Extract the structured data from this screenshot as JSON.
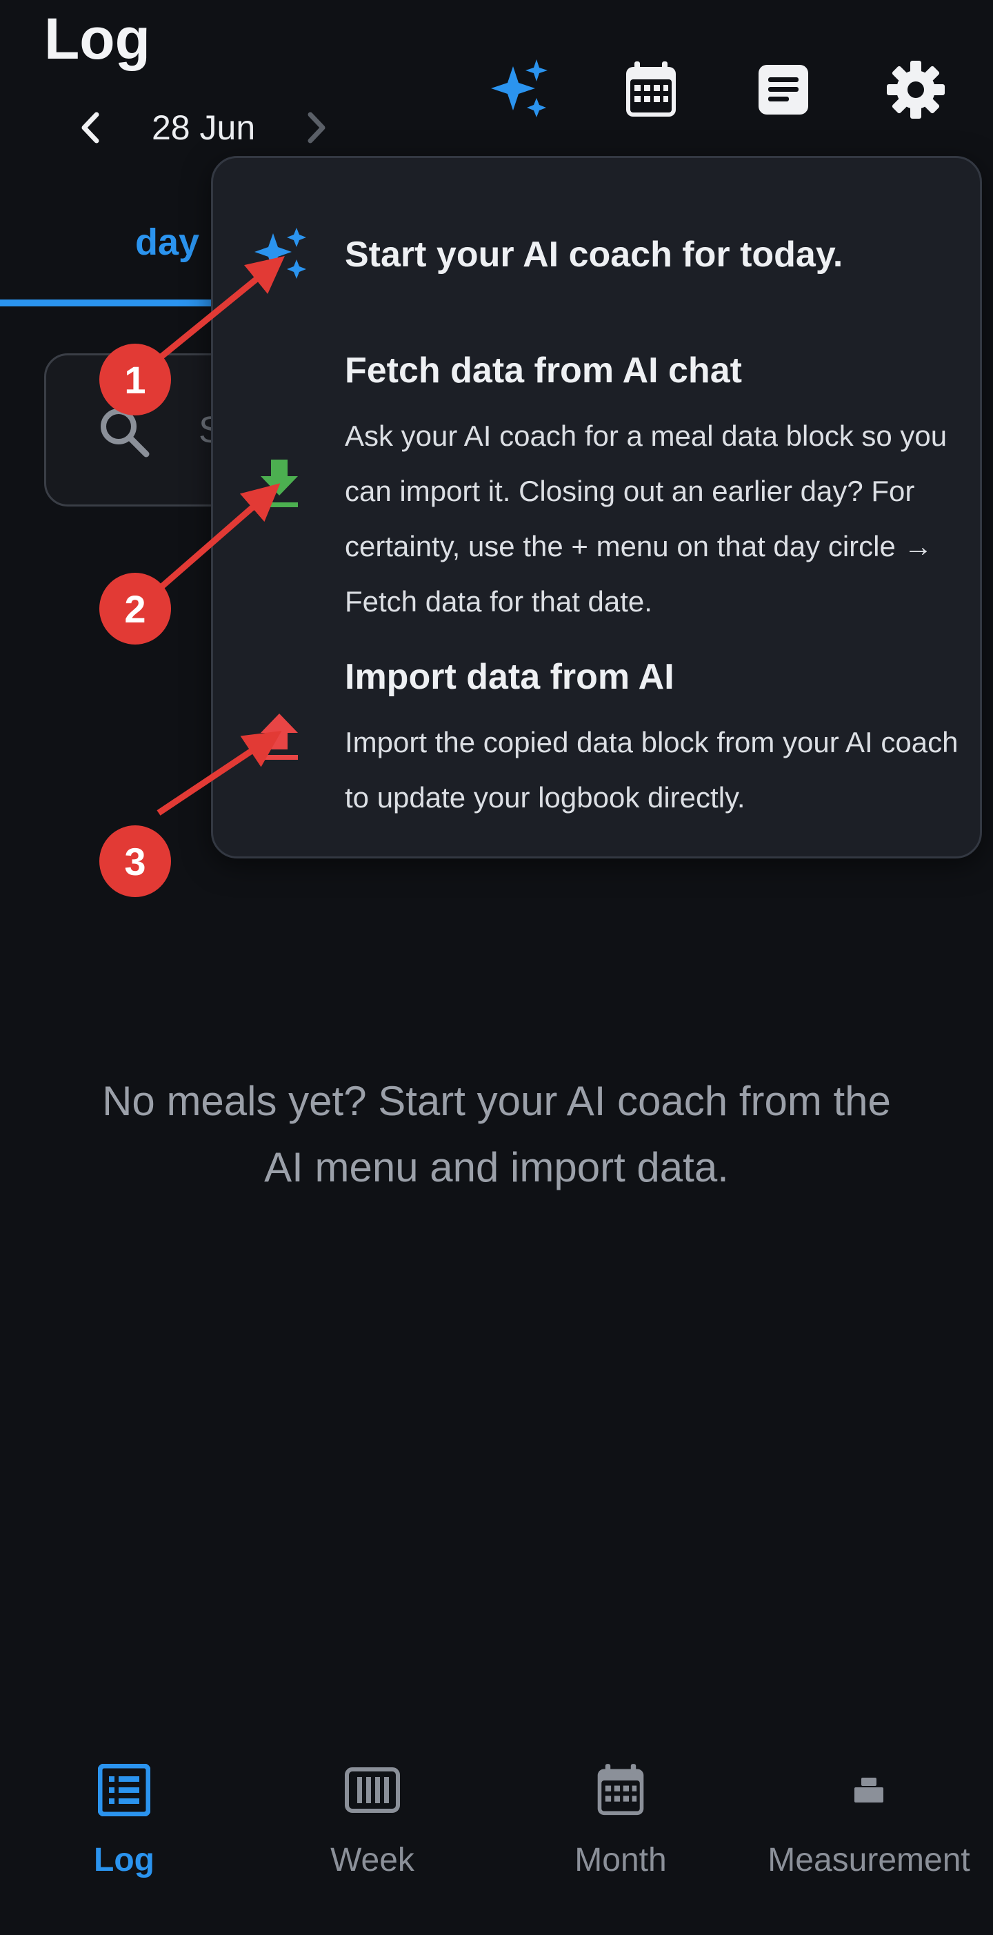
{
  "header": {
    "title": "Log",
    "date": "28 Jun",
    "icons": [
      "sparkles-icon",
      "calendar-icon",
      "notes-icon",
      "gear-icon"
    ]
  },
  "tabs": {
    "active_label": "day"
  },
  "search": {
    "placeholder": "S"
  },
  "popup": {
    "items": [
      {
        "title": "Start your AI coach for today.",
        "icon": "sparkles-icon"
      },
      {
        "title": "Fetch data from AI chat",
        "description": "Ask your AI coach for a meal data block so you can import it. Closing out an earlier day? For certainty, use the + menu on that day circle → Fetch data for that date.",
        "icon": "download-icon"
      },
      {
        "title": "Import data from AI",
        "description": "Import the copied data block from your AI coach to update your logbook directly.",
        "icon": "upload-icon"
      }
    ]
  },
  "annotations": {
    "badges": [
      "1",
      "2",
      "3"
    ],
    "color": "#e23a35"
  },
  "empty_state": {
    "text": "No meals yet? Start your AI coach from the AI menu and import data."
  },
  "bottom_nav": {
    "items": [
      {
        "label": "Log",
        "icon": "list-icon",
        "active": true
      },
      {
        "label": "Week",
        "icon": "week-columns-icon",
        "active": false
      },
      {
        "label": "Month",
        "icon": "calendar-icon",
        "active": false
      },
      {
        "label": "Measurement",
        "icon": "scale-icon",
        "active": false
      }
    ]
  },
  "colors": {
    "accent": "#2b94ef",
    "background": "#0f1115",
    "popup": "#1c1f26",
    "download": "#4caf50",
    "upload": "#e84545"
  }
}
